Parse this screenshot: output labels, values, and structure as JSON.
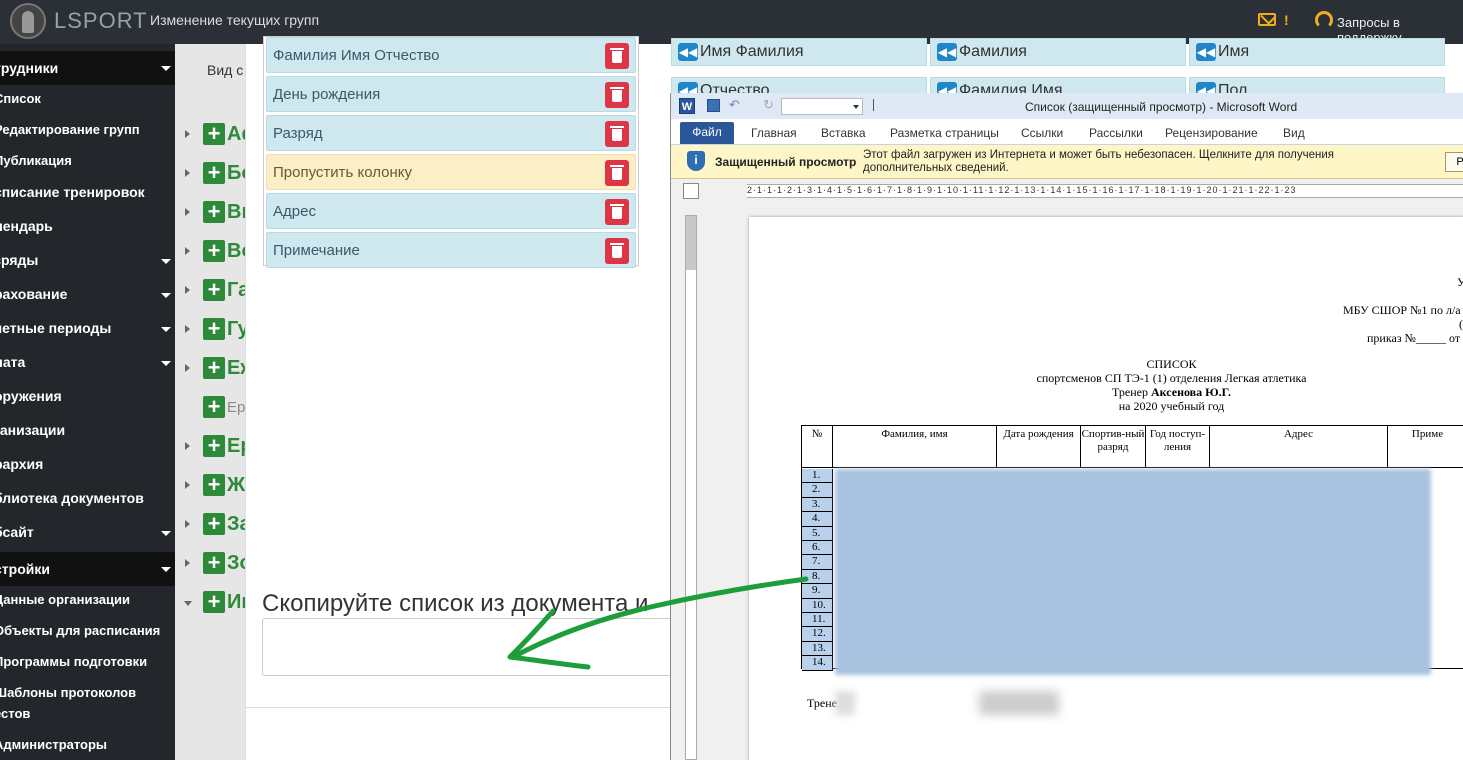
{
  "topbar": {
    "logo_text": "LSPORT",
    "page_title": "Изменение текущих групп",
    "warning_mark": "!",
    "support_label": "Запросы в поддержку"
  },
  "sidebar": {
    "items": [
      {
        "label": "трудники",
        "type": "head",
        "caret": true
      },
      {
        "label": "Список",
        "type": "sub"
      },
      {
        "label": "Редактирование групп",
        "type": "sub"
      },
      {
        "label": "Публикация",
        "type": "sub"
      },
      {
        "label": "списание тренировок",
        "type": "item"
      },
      {
        "label": "лендарь",
        "type": "item"
      },
      {
        "label": "зряды",
        "type": "item",
        "caret": true
      },
      {
        "label": "рахование",
        "type": "item",
        "caret": true
      },
      {
        "label": "четные периоды",
        "type": "item",
        "caret": true
      },
      {
        "label": "лата",
        "type": "item",
        "caret": true
      },
      {
        "label": "оружения",
        "type": "item"
      },
      {
        "label": "ганизации",
        "type": "item"
      },
      {
        "label": "рархия",
        "type": "item"
      },
      {
        "label": "блиотека документов",
        "type": "item"
      },
      {
        "label": "бсайт",
        "type": "item",
        "caret": true
      },
      {
        "label": "стройки",
        "type": "head",
        "caret": true
      },
      {
        "label": "Данные организации",
        "type": "sub"
      },
      {
        "label": "Объекты для расписания",
        "type": "sub"
      },
      {
        "label": "Программы подготовки",
        "type": "sub"
      },
      {
        "label": "Шаблоны протоколов",
        "type": "sub"
      },
      {
        "label": "естов",
        "type": "sub"
      },
      {
        "label": "Администраторы",
        "type": "sub"
      }
    ]
  },
  "tree": {
    "view_label": "Вид с",
    "rows": [
      {
        "label": "Аф"
      },
      {
        "label": "Бо"
      },
      {
        "label": "Ви"
      },
      {
        "label": "Во"
      },
      {
        "label": "Га"
      },
      {
        "label": "Гу"
      },
      {
        "label": "Еж"
      },
      {
        "label": "Ер",
        "grey": true
      },
      {
        "label": "Ер"
      },
      {
        "label": "Жи"
      },
      {
        "label": "За"
      },
      {
        "label": "Зо"
      },
      {
        "label": "Ив"
      }
    ]
  },
  "columns": {
    "selected": [
      {
        "label": "Фамилия Имя Отчество"
      },
      {
        "label": "День рождения"
      },
      {
        "label": "Разряд"
      },
      {
        "label": "Пропустить колонку",
        "skip": true
      },
      {
        "label": "Адрес"
      },
      {
        "label": "Примечание"
      }
    ],
    "available": [
      {
        "label": "Имя Фамилия"
      },
      {
        "label": "Фамилия"
      },
      {
        "label": "Имя"
      },
      {
        "label": "Отчество"
      },
      {
        "label": "Фамилия Имя"
      },
      {
        "label": "Пол"
      }
    ]
  },
  "copy": {
    "title": "Скопируйте список из документа и",
    "textarea_value": ""
  },
  "word": {
    "title": "Список (защищенный просмотр)  -  Microsoft Word",
    "tabs": [
      "Файл",
      "Главная",
      "Вставка",
      "Разметка страницы",
      "Ссылки",
      "Рассылки",
      "Рецензирование",
      "Вид"
    ],
    "protected_label": "Защищенный просмотр",
    "protected_text": "Этот файл загружен из Интернета и может быть небезопасен. Щелкните для получения дополнительных сведений.",
    "protected_button": "Р",
    "ruler_text": "2·1·1·1·2·1·3·1·4·1·5·1·6·1·7·1·8·1·9·1·10·1·11·1·12·1·13·1·14·1·15·1·16·1·17·1·18·1·19·1·20·1·21·1·22·1·23",
    "doc": {
      "corner_1": "У",
      "corner_2": "МБУ СШОР №1 по л/а",
      "corner_3": "(",
      "corner_4": "приказ №_____ от",
      "heading": "СПИСОК",
      "line2": "спортсменов  СП ТЭ-1 (1) отделения  Легкая атлетика",
      "trainer_prefix": "Тренер ",
      "trainer_name": "Аксенова Ю.Г.",
      "year_line": "на 2020 учебный год",
      "table_headers": [
        "№",
        "Фамилия, имя",
        "Дата рождения",
        "Спортив-ный разряд",
        "Год поступ-ления",
        "Адрес",
        "Приме"
      ],
      "row_numbers": [
        "1.",
        "2.",
        "3.",
        "4.",
        "5.",
        "6.",
        "7.",
        "8.",
        "9.",
        "10.",
        "11.",
        "12.",
        "13.",
        "14."
      ],
      "footer": "Трене"
    }
  },
  "colors": {
    "sidebar_bg": "#23272b",
    "accent_green": "#2c8a3a",
    "column_bg": "#cfe8ef",
    "skip_bg": "#fcefc7",
    "delete_red": "#dc3545",
    "word_blue": "#2b579a",
    "annotation_arrow": "#1e9e3a"
  }
}
